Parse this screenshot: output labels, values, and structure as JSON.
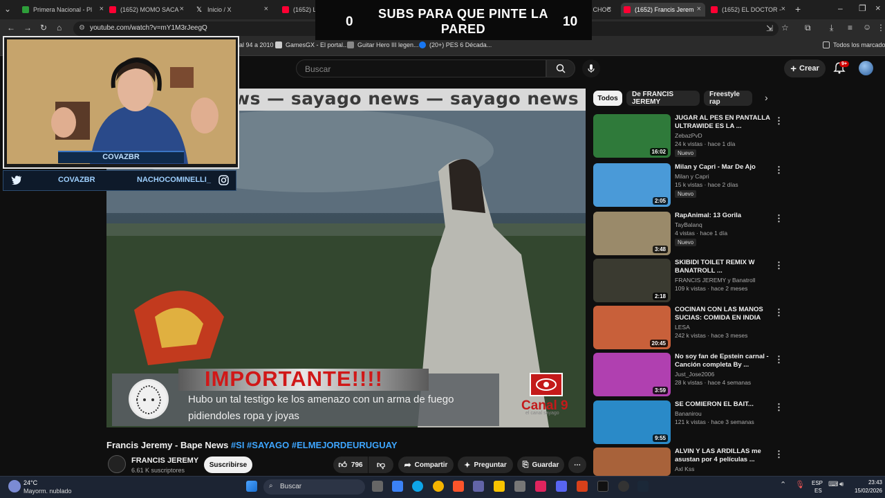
{
  "browser": {
    "tabs": [
      {
        "label": "Primera Nacional - Pl",
        "color": "#2e9e3a"
      },
      {
        "label": "(1652) MOMO SACA",
        "color": "#ff0033"
      },
      {
        "label": "Inicio / X",
        "color": "#ffffff"
      },
      {
        "label": "(1652) LOLO - YouTu",
        "color": "#ff0033"
      },
      {
        "label": "",
        "color": "#ffffff"
      },
      {
        "label": "(1652) LOLO, CHOC",
        "color": "#ff0033"
      },
      {
        "label": "(1652) Francis Jerem",
        "color": "#ff0033"
      },
      {
        "label": "(1652) EL DOCTOR -",
        "color": "#ff0033"
      }
    ],
    "url": "youtube.com/watch?v=mY1M3rJeegQ",
    "bookmarks": [
      "al 94 a 2010",
      "GamesGX - El portal...",
      "Guitar Hero III legen...",
      "(20+) PES 6 Década..."
    ],
    "all_bookmarks": "Todos los marcadores"
  },
  "overlay": {
    "score_left": "0",
    "score_right": "10",
    "title": "SUBS PARA QUE PINTE LA PARED",
    "cam_name": "COVAZBR",
    "social_twitter": "COVAZBR",
    "social_instagram": "NACHOCOMINELLI_"
  },
  "youtube": {
    "search_placeholder": "Buscar",
    "create_label": "Crear",
    "notif_badge": "9+",
    "video": {
      "ticker": "ws — sayago news — sayago news — sayago news — saya",
      "important": "IMPORTANTE!!!!",
      "news_line": "Hubo un tal testigo ke los amenazo con un arma de fuego pidiendoles ropa y joyas",
      "canal": "Canal 9",
      "canal_sub": "el canal sayago",
      "title": "Francis Jeremy - Bape News",
      "tags": "#SI #SAYAGO #ELMEJORDEURUGUAY",
      "channel": "FRANCIS JEREMY",
      "subs": "6.61 K suscriptores",
      "subscribe": "Suscribirse",
      "likes": "796",
      "share": "Compartir",
      "ask": "Preguntar",
      "save": "Guardar"
    },
    "chips": [
      "Todos",
      "De FRANCIS JEREMY",
      "Freestyle rap"
    ],
    "recommendations": [
      {
        "title": "JUGAR AL PES EN PANTALLA ULTRAWIDE ES LA ...",
        "channel": "ZebazPvD",
        "views": "24 k vistas · hace 1 día",
        "badge": "Nuevo",
        "duration": "16:02",
        "thumb": "#2f7a3a"
      },
      {
        "title": "Milan y Capri - Mar De Ajo",
        "channel": "Milan y Capri",
        "views": "15 k vistas · hace 2 días",
        "badge": "Nuevo",
        "duration": "2:05",
        "thumb": "#4a9ad8"
      },
      {
        "title": "RapAnimal: 13 Gorila",
        "channel": "TayBalanq",
        "views": "4 vistas · hace 1 día",
        "badge": "Nuevo",
        "duration": "3:48",
        "thumb": "#9a8a6a"
      },
      {
        "title": "SKIBIDI TOILET REMIX W BANATROLL ...",
        "channel": "FRANCIS JEREMY y Banatroll",
        "views": "109 k vistas · hace 2 meses",
        "badge": "",
        "duration": "2:18",
        "thumb": "#3a3a30"
      },
      {
        "title": "COCINAN CON LAS MANOS SUCIAS: COMIDA EN INDIA",
        "channel": "LESA",
        "views": "242 k vistas · hace 3 meses",
        "badge": "",
        "duration": "20:45",
        "thumb": "#c8603a"
      },
      {
        "title": "No soy fan de Epstein carnal - Canción completa By ...",
        "channel": "Just_Jose2006",
        "views": "28 k vistas · hace 4 semanas",
        "badge": "",
        "duration": "3:59",
        "thumb": "#b040b0"
      },
      {
        "title": "SE COMIERON EL BAIT...",
        "channel": "Bananirou",
        "views": "121 k vistas · hace 3 semanas",
        "badge": "",
        "duration": "9:55",
        "thumb": "#2a8ac8"
      },
      {
        "title": "ALVIN Y LAS ARDILLAS me asustan por 4 películas ...",
        "channel": "Axl Kss",
        "views": "",
        "badge": "",
        "duration": "",
        "thumb": "#a8623a"
      }
    ]
  },
  "taskbar": {
    "temp": "24°C",
    "weather": "Mayorm. nublado",
    "search": "Buscar",
    "lang1": "ESP",
    "lang2": "ES",
    "time": "23:43",
    "date": "15/02/2026"
  }
}
